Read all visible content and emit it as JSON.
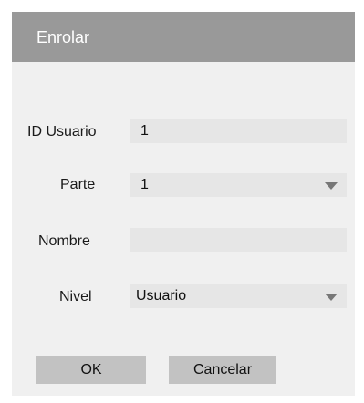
{
  "dialog": {
    "title": "Enrolar"
  },
  "form": {
    "id_usuario": {
      "label": "ID Usuario",
      "value": "1"
    },
    "parte": {
      "label": "Parte",
      "value": "1"
    },
    "nombre": {
      "label": "Nombre",
      "value": ""
    },
    "nivel": {
      "label": "Nivel",
      "value": "Usuario"
    }
  },
  "buttons": {
    "ok": "OK",
    "cancel": "Cancelar"
  },
  "icons": {
    "parte_dropdown": "chevron-down-icon",
    "nivel_dropdown": "chevron-down-icon"
  },
  "colors": {
    "titlebar": "#999999",
    "background": "#f0f0f0",
    "field": "#e6e6e6",
    "button": "#c2c2c2"
  }
}
